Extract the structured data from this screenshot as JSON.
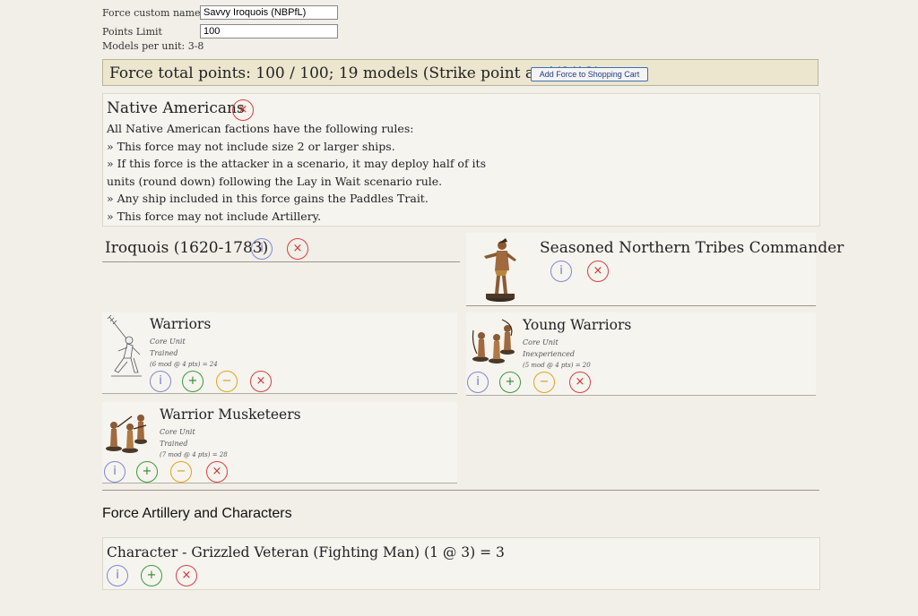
{
  "form": {
    "name_label": "Force custom name:",
    "name_value": "Savvy Iroquois (NBPfL)",
    "points_label": "Points Limit",
    "points_value": "100",
    "models_per_unit": "Models per unit: 3-8"
  },
  "total": {
    "text": "Force total points: 100 / 100; 19 models (Strike point at 4/8/12)",
    "cart_button": "Add Force to Shopping Cart"
  },
  "faction": {
    "title": "Native Americans",
    "rules": [
      "All Native American factions have the following rules:",
      "» This force may not include size 2 or larger ships.",
      "» If this force is the attacker in a scenario, it may deploy half of its",
      "units (round down) following the Lay in Wait scenario rule.",
      "» Any ship included in this force gains the Paddles Trait.",
      "» This force may not include Artillery."
    ]
  },
  "list": {
    "title": "Iroquois (1620-1783)"
  },
  "commander": {
    "name": "Seasoned Northern Tribes Commander"
  },
  "units": [
    {
      "name": "Warriors",
      "type": "Core Unit",
      "quality": "Trained",
      "cost": "(6 mod @ 4 pts) = 24"
    },
    {
      "name": "Young Warriors",
      "type": "Core Unit",
      "quality": "Inexperienced",
      "cost": "(5 mod @ 4 pts) = 20"
    },
    {
      "name": "Warrior Musketeers",
      "type": "Core Unit",
      "quality": "Trained",
      "cost": "(7 mod @ 4 pts) = 28"
    }
  ],
  "section": {
    "title": "Force Artillery and Characters"
  },
  "character": {
    "text": "Character - Grizzled Veteran (Fighting Man) (1 @ 3) = 3"
  },
  "icons": {
    "info": "i",
    "add": "+",
    "remove": "−",
    "delete": "×"
  },
  "colors": {
    "info": "#6a72c8",
    "add": "#2a8a2a",
    "remove": "#d69a10",
    "delete": "#d03030"
  }
}
